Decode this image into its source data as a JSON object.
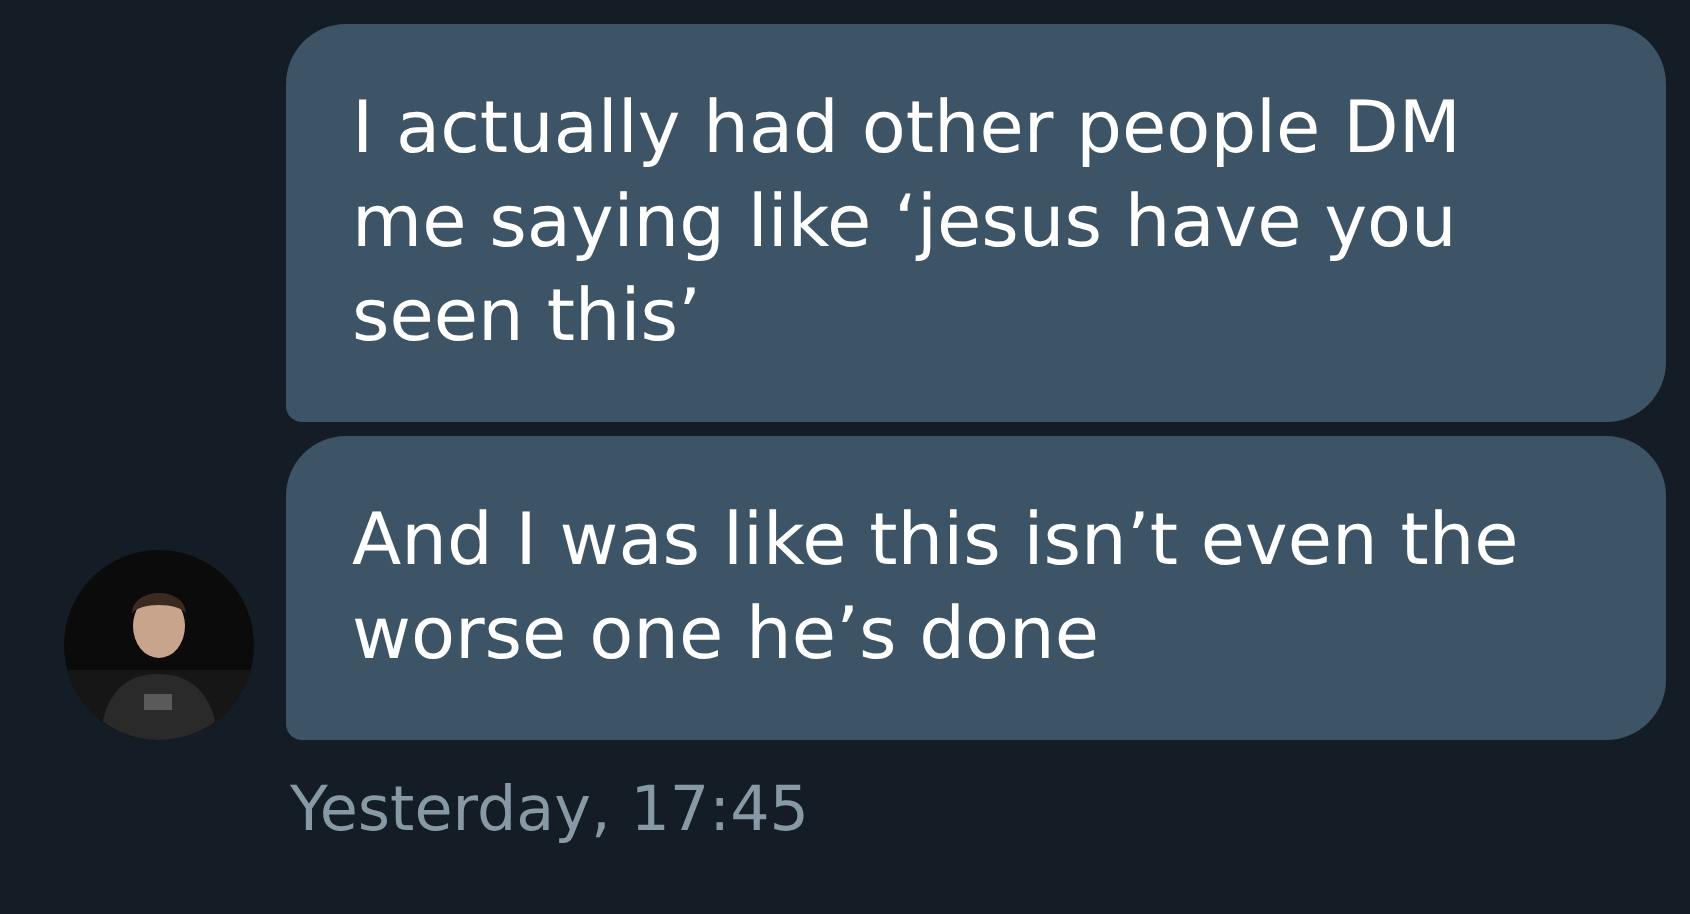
{
  "messages": [
    {
      "text": "I actually had other people DM me saying like ‘jesus have you seen this’",
      "avatar": false
    },
    {
      "text": "And I was like this isn’t even the worse one he’s done",
      "avatar": true
    }
  ],
  "timestamp": "Yesterday, 17:45"
}
